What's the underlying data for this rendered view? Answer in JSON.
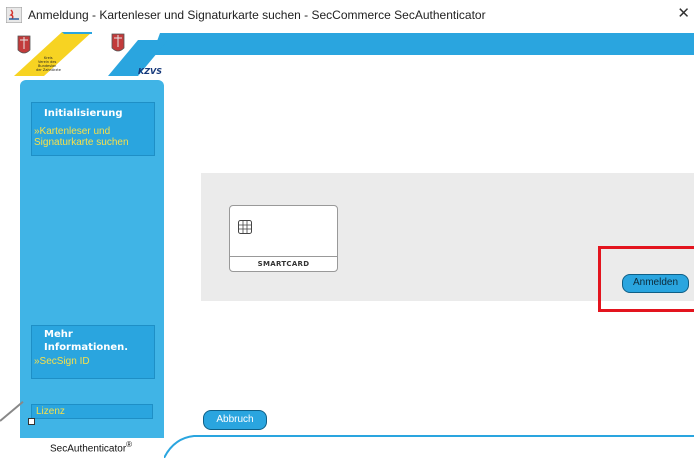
{
  "window": {
    "title": "Anmeldung - Kartenleser und Signaturkarte suchen - SecCommerce SecAuthenticator",
    "close_glyph": "✕"
  },
  "logos": {
    "left_text": "Kreis\nVerein des\nBundeslan\nder Zahnärzte",
    "right_text": "KZVS"
  },
  "sidebar": {
    "init_title": "Initialisierung",
    "init_link": "»Kartenleser und Signaturkarte suchen",
    "more_title": "Mehr Informationen.",
    "more_link": "»SecSign ID",
    "lizenz": "Lizenz",
    "brand": "SecAuthenticator",
    "brand_mark": "®"
  },
  "main": {
    "smartcard_label": "SMARTCARD",
    "anmelden_label": "Anmelden",
    "abbruch_label": "Abbruch"
  },
  "colors": {
    "accent_blue": "#2aa5df",
    "highlight_red": "#e3141e",
    "link_yellow": "#f7e04a"
  }
}
